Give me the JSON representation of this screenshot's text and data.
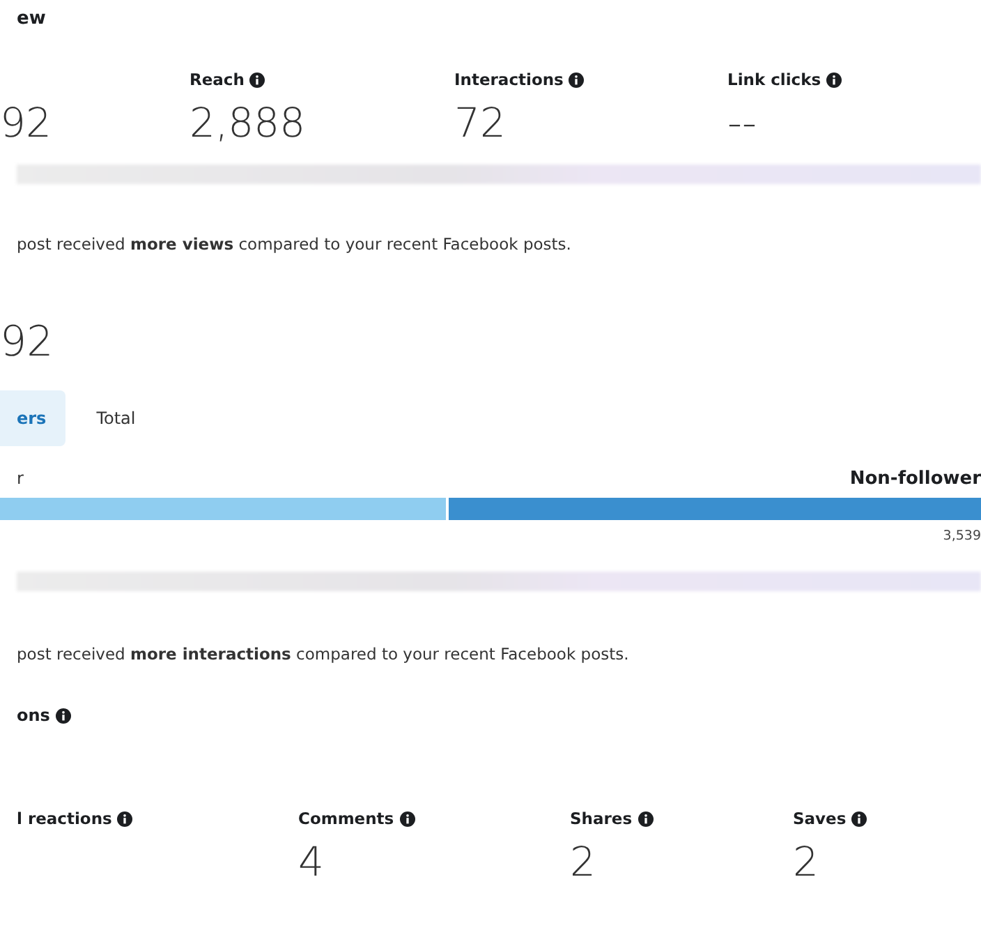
{
  "overview": {
    "title": "ew",
    "metrics": [
      {
        "value": "92"
      },
      {
        "label": "Reach",
        "value": "2,888"
      },
      {
        "label": "Interactions",
        "value": "72"
      },
      {
        "label": "Link clicks",
        "value": "--"
      }
    ]
  },
  "views": {
    "summary": "post received **more views** compared to your recent Facebook posts.",
    "total": "92",
    "tabs": [
      {
        "label": "ers",
        "selected": true
      },
      {
        "label": "Total",
        "selected": false
      }
    ],
    "split": {
      "left_label": "r",
      "right_label": "Non-follower",
      "level": 0.455,
      "right_value": "3,539"
    }
  },
  "interactions": {
    "summary": "post received **more interactions** compared to your recent Facebook posts.",
    "title": "ons",
    "metrics": [
      {
        "label": "l reactions"
      },
      {
        "label": "Comments",
        "value": "4"
      },
      {
        "label": "Shares",
        "value": "2"
      },
      {
        "label": "Saves",
        "value": "2"
      }
    ]
  }
}
